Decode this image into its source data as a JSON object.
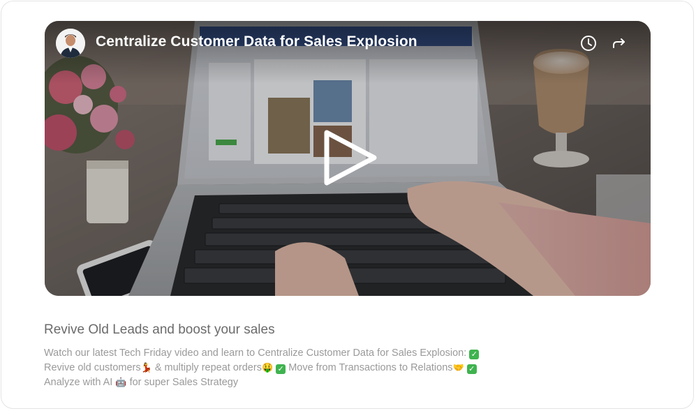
{
  "video": {
    "title": "Centralize Customer Data for Sales Explosion",
    "avatar_icon": "presenter-avatar",
    "watch_later_icon": "clock-icon",
    "share_icon": "share-arrow-icon",
    "play_icon": "play-icon"
  },
  "post": {
    "heading": "Revive Old Leads and boost your sales",
    "line1_text": "Watch our latest Tech Friday video and learn to Centralize Customer Data for Sales Explosion: ",
    "line1_emoji": "✅",
    "line2_a": "Revive old customers",
    "line2_emoji1": "💃",
    "line2_b": " & multiply repeat orders",
    "line2_emoji2": "🤑",
    "line2_check1": "✓",
    "line2_c": " Move from Transactions to Relations",
    "line2_emoji3": "🤝",
    "line2_check2": "✓",
    "line3_a": "Analyze with AI ",
    "line3_emoji": "🤖",
    "line3_b": " for super Sales Strategy",
    "check_label": "✓"
  },
  "colors": {
    "title_text": "#ffffff",
    "heading_text": "#6b6b6b",
    "body_text": "#9a9a9a",
    "check_green": "#3fb34f"
  }
}
